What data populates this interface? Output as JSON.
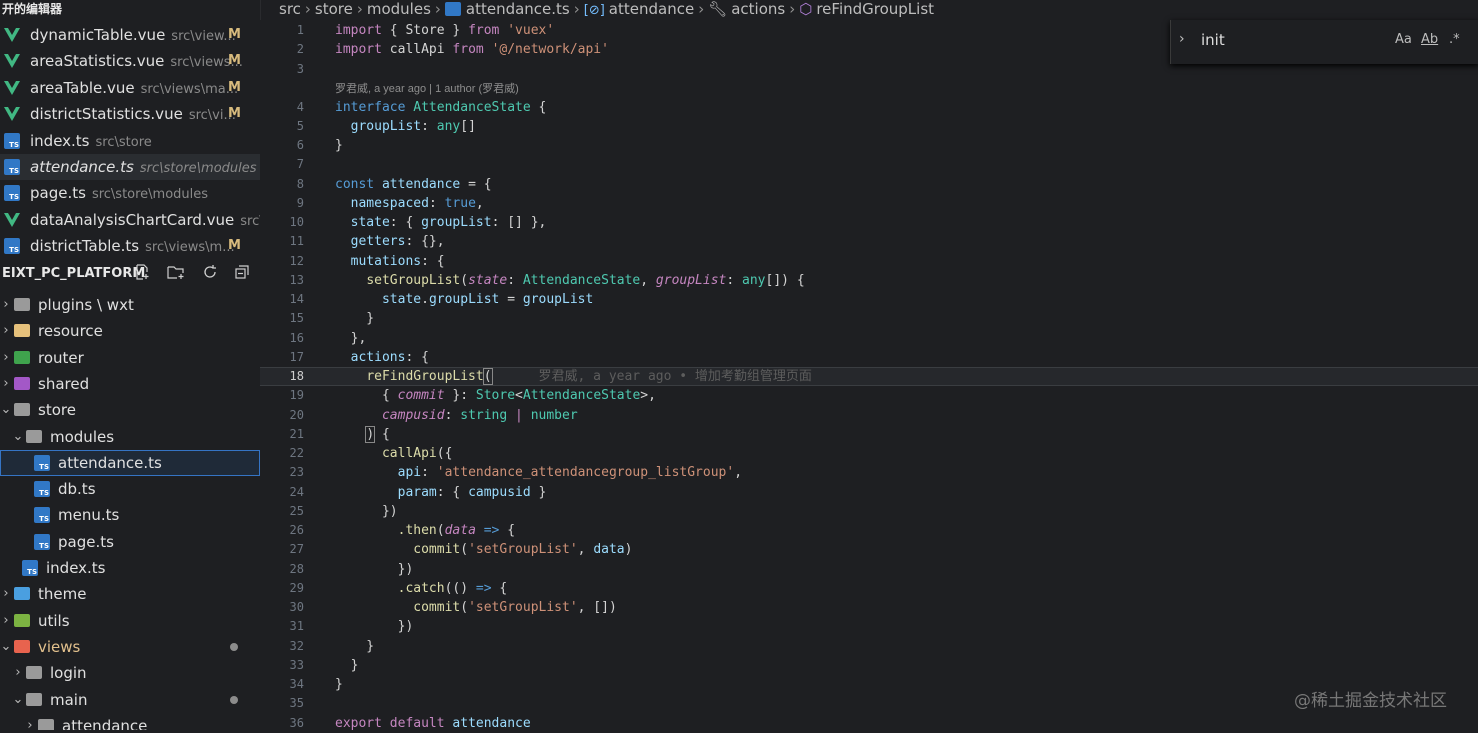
{
  "open_editors": {
    "header": "开的编辑器",
    "items": [
      {
        "name": "dynamicTable.vue",
        "path": "src\\view...",
        "status": "M",
        "type": "vue",
        "active": false,
        "italic": false
      },
      {
        "name": "areaStatistics.vue",
        "path": "src\\views...",
        "status": "M",
        "type": "vue",
        "active": false,
        "italic": false
      },
      {
        "name": "areaTable.vue",
        "path": "src\\views\\ma...",
        "status": "M",
        "type": "vue",
        "active": false,
        "italic": false
      },
      {
        "name": "districtStatistics.vue",
        "path": "src\\vi...",
        "status": "M",
        "type": "vue",
        "active": false,
        "italic": false
      },
      {
        "name": "index.ts",
        "path": "src\\store",
        "status": "",
        "type": "ts",
        "active": false,
        "italic": false
      },
      {
        "name": "attendance.ts",
        "path": "src\\store\\modules",
        "status": "",
        "type": "ts",
        "active": true,
        "italic": true
      },
      {
        "name": "page.ts",
        "path": "src\\store\\modules",
        "status": "",
        "type": "ts",
        "active": false,
        "italic": false
      },
      {
        "name": "dataAnalysisChartCard.vue",
        "path": "src\\...",
        "status": "",
        "type": "vue",
        "active": false,
        "italic": false
      },
      {
        "name": "districtTable.ts",
        "path": "src\\views\\m...",
        "status": "M",
        "type": "ts",
        "active": false,
        "italic": false
      }
    ]
  },
  "project": {
    "title": "EIXT_PC_PLATFORM",
    "icons": [
      "new-file-icon",
      "new-folder-icon",
      "refresh-icon",
      "collapse-all-icon"
    ]
  },
  "tree": [
    {
      "label": "plugins \\ wxt",
      "depth": 0,
      "kind": "folder",
      "open": false,
      "color": "#9a9a9a"
    },
    {
      "label": "resource",
      "depth": 0,
      "kind": "folder",
      "open": false,
      "color": "#e5c07b"
    },
    {
      "label": "router",
      "depth": 0,
      "kind": "folder",
      "open": false,
      "color": "#3fa34d"
    },
    {
      "label": "shared",
      "depth": 0,
      "kind": "folder",
      "open": false,
      "color": "#a358c7"
    },
    {
      "label": "store",
      "depth": 0,
      "kind": "folder",
      "open": true,
      "color": "#9a9a9a"
    },
    {
      "label": "modules",
      "depth": 1,
      "kind": "folder",
      "open": true,
      "color": "#9a9a9a"
    },
    {
      "label": "attendance.ts",
      "depth": 2,
      "kind": "ts",
      "selected": true
    },
    {
      "label": "db.ts",
      "depth": 2,
      "kind": "ts"
    },
    {
      "label": "menu.ts",
      "depth": 2,
      "kind": "ts"
    },
    {
      "label": "page.ts",
      "depth": 2,
      "kind": "ts"
    },
    {
      "label": "index.ts",
      "depth": 1,
      "kind": "ts"
    },
    {
      "label": "theme",
      "depth": 0,
      "kind": "folder",
      "open": false,
      "color": "#4a9fe0"
    },
    {
      "label": "utils",
      "depth": 0,
      "kind": "folder",
      "open": false,
      "color": "#7cb342"
    },
    {
      "label": "views",
      "depth": 0,
      "kind": "folder",
      "open": true,
      "color": "#e8634e",
      "dot": true,
      "orange": true
    },
    {
      "label": "login",
      "depth": 1,
      "kind": "folder",
      "open": false,
      "color": "#9a9a9a"
    },
    {
      "label": "main",
      "depth": 1,
      "kind": "folder",
      "open": true,
      "color": "#9a9a9a",
      "dot": true
    },
    {
      "label": "attendance",
      "depth": 2,
      "kind": "folder",
      "open": false,
      "color": "#9a9a9a"
    }
  ],
  "breadcrumbs": [
    "src",
    "store",
    "modules",
    "attendance.ts",
    "attendance",
    "actions",
    "reFindGroupList"
  ],
  "find": {
    "value": "init",
    "opt_case": "Aa",
    "opt_word": "Ab",
    "opt_regex": ".*"
  },
  "blame": {
    "header": "罗君威, a year ago | 1 author (罗君威)",
    "inline": "罗君威, a year ago • 增加考勤组管理页面"
  },
  "code": {
    "l1": {
      "n": "1"
    },
    "l2": {
      "n": "2"
    },
    "l3": {
      "n": "3"
    },
    "l4": {
      "n": "4"
    },
    "l5": {
      "n": "5"
    },
    "l6": {
      "n": "6"
    },
    "l7": {
      "n": "7"
    },
    "l8": {
      "n": "8"
    },
    "l9": {
      "n": "9"
    },
    "l10": {
      "n": "10"
    },
    "l11": {
      "n": "11"
    },
    "l12": {
      "n": "12"
    },
    "l13": {
      "n": "13"
    },
    "l14": {
      "n": "14"
    },
    "l15": {
      "n": "15"
    },
    "l16": {
      "n": "16"
    },
    "l17": {
      "n": "17"
    },
    "l18": {
      "n": "18"
    },
    "l19": {
      "n": "19"
    },
    "l20": {
      "n": "20"
    },
    "l21": {
      "n": "21"
    },
    "l22": {
      "n": "22"
    },
    "l23": {
      "n": "23"
    },
    "l24": {
      "n": "24"
    },
    "l25": {
      "n": "25"
    },
    "l26": {
      "n": "26"
    },
    "l27": {
      "n": "27"
    },
    "l28": {
      "n": "28"
    },
    "l29": {
      "n": "29"
    },
    "l30": {
      "n": "30"
    },
    "l31": {
      "n": "31"
    },
    "l32": {
      "n": "32"
    },
    "l33": {
      "n": "33"
    },
    "l34": {
      "n": "34"
    },
    "l35": {
      "n": "35"
    },
    "l36": {
      "n": "36"
    },
    "t": {
      "import": "import",
      "from": "from",
      "store": "Store",
      "vuex": "'vuex'",
      "callApi": "callApi",
      "api_path": "'@/network/api'",
      "interface": "interface",
      "AttendanceState": "AttendanceState",
      "groupList": "groupList",
      "any": "any",
      "const": "const",
      "attendance": "attendance",
      "namespaced": "namespaced",
      "true": "true",
      "state": "state",
      "getters": "getters",
      "mutations": "mutations",
      "setGroupList": "setGroupList",
      "actions": "actions",
      "reFindGroupList": "reFindGroupList",
      "commit": "commit",
      "campusid": "campusid",
      "string": "string",
      "number": "number",
      "api": "api",
      "api_str": "'attendance_attendancegroup_listGroup'",
      "param": "param",
      "then": ".then",
      "data": "data",
      "catch": ".catch",
      "setGroupList_str": "'setGroupList'",
      "export": "export",
      "default": "default"
    }
  },
  "watermark": "@稀土掘金技术社区"
}
